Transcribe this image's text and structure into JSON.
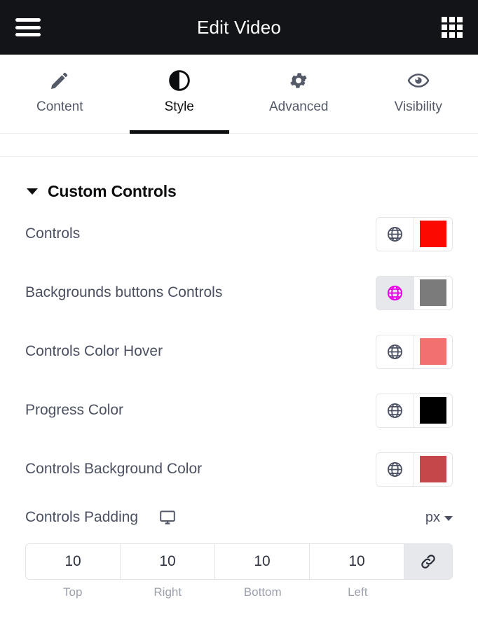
{
  "topbar": {
    "title": "Edit Video",
    "menu_icon": "hamburger-menu-icon",
    "apps_icon": "grid-apps-icon"
  },
  "tabs": [
    {
      "label": "Content",
      "icon": "pencil-icon",
      "active": false
    },
    {
      "label": "Style",
      "icon": "contrast-icon",
      "active": true
    },
    {
      "label": "Advanced",
      "icon": "gear-icon",
      "active": false
    },
    {
      "label": "Visibility",
      "icon": "eye-icon",
      "active": false
    }
  ],
  "section": {
    "title": "Custom Controls",
    "expanded": true
  },
  "controls": [
    {
      "label": "Controls",
      "globe_icon": "globe-icon",
      "globe_active": false,
      "swatch_color": "#fa0a00"
    },
    {
      "label": "Backgrounds buttons Controls",
      "globe_icon": "globe-icon",
      "globe_active": true,
      "swatch_color": "#7b7b7b"
    },
    {
      "label": "Controls Color Hover",
      "globe_icon": "globe-icon",
      "globe_active": false,
      "swatch_color": "#f2706e"
    },
    {
      "label": "Progress Color",
      "globe_icon": "globe-icon",
      "globe_active": false,
      "swatch_color": "#000000"
    },
    {
      "label": "Controls Background Color",
      "globe_icon": "globe-icon",
      "globe_active": false,
      "swatch_color": "#c6474a"
    }
  ],
  "padding": {
    "title": "Controls Padding",
    "device_icon": "desktop-monitor-icon",
    "unit": "px",
    "unit_chevron": "chevron-down-icon",
    "link_icon": "link-chain-icon",
    "linked": true,
    "values": {
      "top": "10",
      "right": "10",
      "bottom": "10",
      "left": "10"
    },
    "labels": {
      "top": "Top",
      "right": "Right",
      "bottom": "Bottom",
      "left": "Left"
    }
  }
}
